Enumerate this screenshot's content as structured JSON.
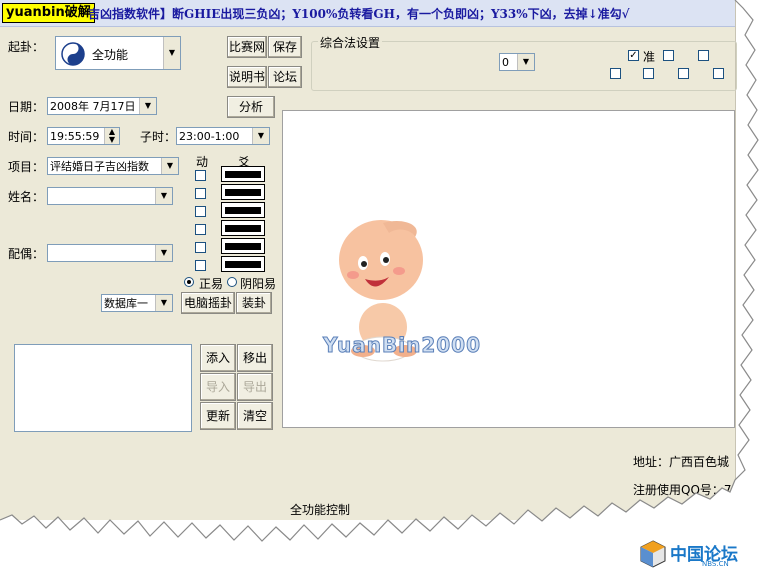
{
  "title": {
    "badge": "yuanbin破解",
    "text": "吉凶指数软件】断GHIE出现三负凶；Y100%负转看GH，有一个负即凶；Y33%下凶，去掉↓准勾√"
  },
  "form": {
    "qigua_label": "起卦：",
    "qigua_value": "全功能",
    "date_label": "日期：",
    "date_value": "2008年 7月17日",
    "time_label": "时间：",
    "time_value": "19:55:59",
    "zishi_label": "子时：",
    "zishi_value": "23:00-1:00",
    "item_label": "项目：",
    "item_value": "评结婚日子吉凶指数",
    "name_label": "姓名：",
    "name_value": "",
    "spouse_label": "配偶：",
    "spouse_value": "",
    "db_value": "数据库一"
  },
  "buttons": {
    "bisai": "比赛网",
    "save": "保存",
    "manual": "说明书",
    "forum": "论坛",
    "analyze": "分析",
    "computer_shake": "电脑摇卦",
    "arrange": "装卦",
    "add": "添入",
    "remove": "移出",
    "import": "导入",
    "export": "导出",
    "update": "更新",
    "clear": "清空"
  },
  "hexagram": {
    "dong_label": "动",
    "yao_label": "爻",
    "lines": [
      "yang",
      "yang",
      "yang",
      "yang",
      "yang",
      "yang"
    ],
    "mode_zhengyi": "正易",
    "mode_yinyang": "阴阳易",
    "selected_mode": "正易"
  },
  "settings": {
    "group_label": "综合法设置",
    "select_value": "0",
    "zhun_label": "准",
    "zhun_checked": true
  },
  "status": {
    "address": "地址：广西百色城",
    "register": "注册使用QQ号：7",
    "bottom": "全功能控制"
  },
  "watermark": {
    "character_text": "YuanBin2000",
    "forum_logo": "中国论坛",
    "forum_sub": "NBS.CN"
  },
  "colors": {
    "window_bg": "#ece9d8",
    "title_text": "#1a1aa0",
    "badge_bg": "#ffff00"
  }
}
